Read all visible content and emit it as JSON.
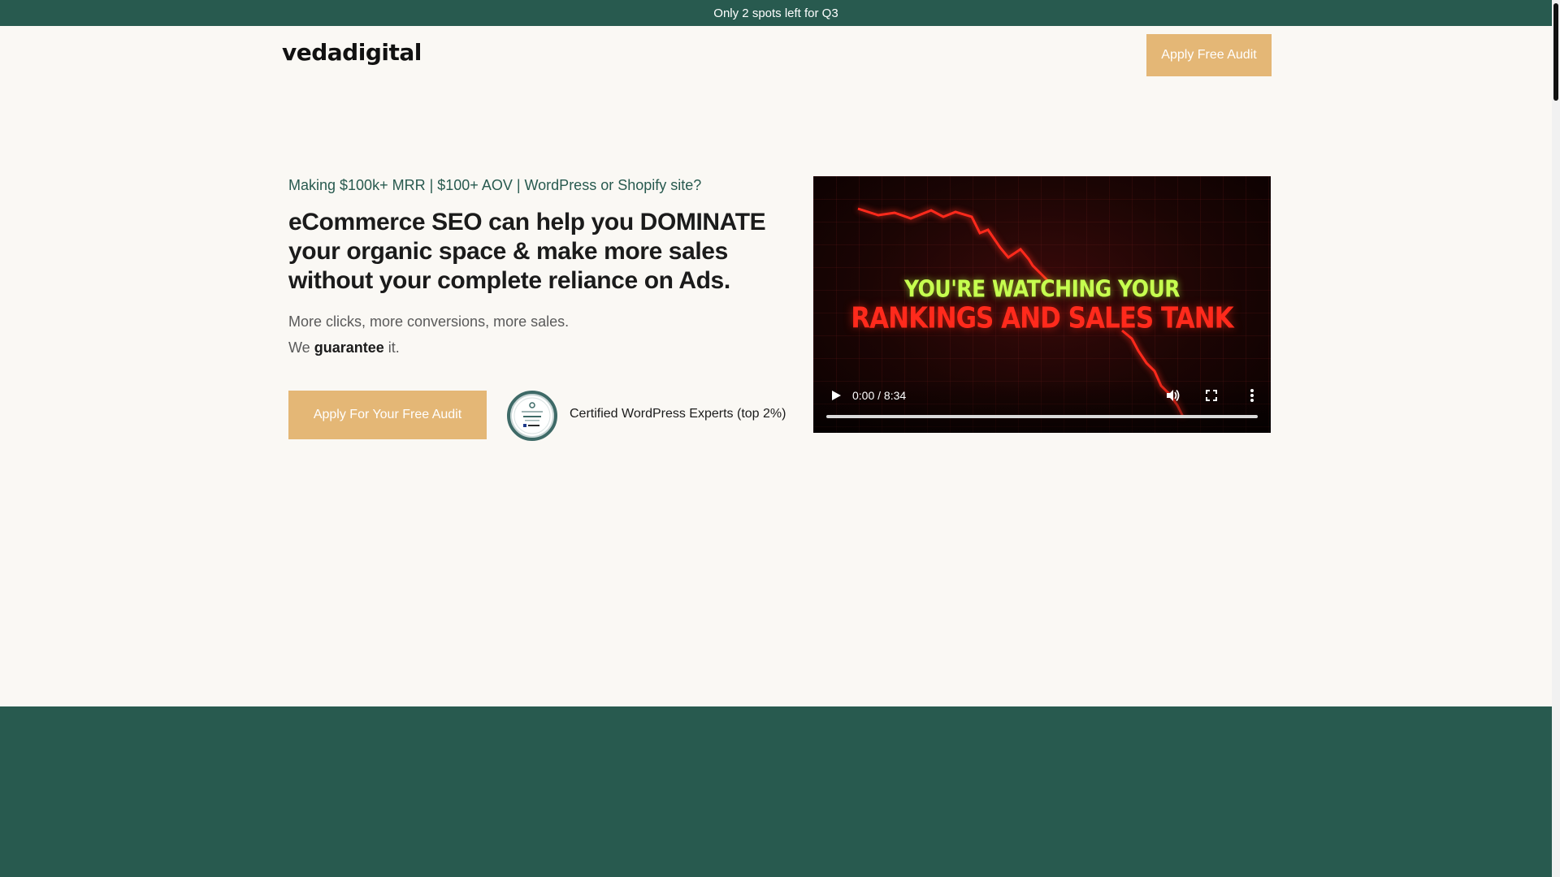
{
  "topbar": {
    "text": "Only 2 spots left for Q3"
  },
  "header": {
    "logo": "vedadigital",
    "cta_label": "Apply Free Audit"
  },
  "hero": {
    "pre_title": "Making $100k+ MRR | $100+ AOV | WordPress or Shopify site?",
    "title": "eCommerce SEO can help you DOMINATE your organic space & make more sales without your complete reliance on Ads.",
    "sub_line1": "More clicks, more conversions, more sales.",
    "sub_line2_prefix": "We",
    "sub_line2_bold": "guarantee",
    "sub_line2_suffix": "it.",
    "cta_label": "Apply For Your Free Audit",
    "badge_text": "Certified WordPress Experts (top 2%)"
  },
  "video": {
    "thumb_line1": "YOU'RE WATCHING YOUR",
    "thumb_line2": "RANKINGS AND SALES TANK",
    "time": "0:00 / 8:34",
    "progress": 0,
    "icons": [
      "play-icon",
      "volume-icon",
      "fullscreen-icon",
      "more-vert-icon"
    ]
  },
  "colors": {
    "brand_green": "#285a4f",
    "accent_gold": "#e4b776",
    "background": "#faf8f4"
  }
}
